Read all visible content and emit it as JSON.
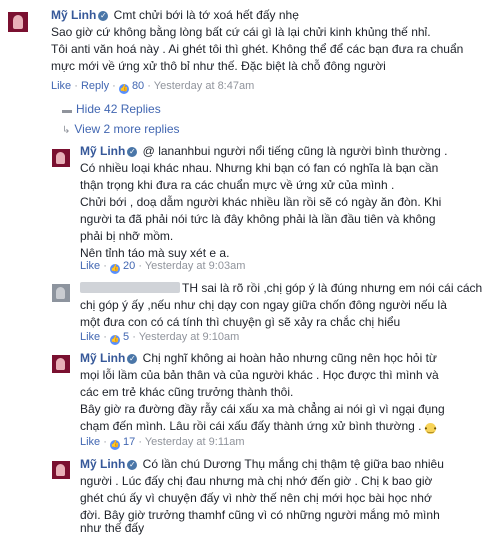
{
  "comments": [
    {
      "name": "Mỹ Linh",
      "lines": [
        "Cmt chửi bới là tớ xoá hết đấy nhẹ",
        "Sao giờ cứ không bằng lòng bất cứ cái gì là lại chửi kinh khủng thế nhỉ.",
        "Tôi anti văn hoá này . Ai ghét tôi thì ghét. Không thể để các bạn đưa ra chuẩn",
        "mực mới về ứng xử thô bỉ như thế. Đặc biệt là chỗ đông người"
      ],
      "like": "Like",
      "reply": "Reply",
      "count": "80",
      "time": "Yesterday at 8:47am"
    }
  ],
  "hide_replies": "Hide 42 Replies",
  "view_more": "View 2 more replies",
  "replies": [
    {
      "name": "Mỹ Linh",
      "lines": [
        "@ lananhbui người nổi tiếng cũng là người bình thường .",
        "Có nhiều loại khác nhau. Nhưng khi bạn có fan có nghĩa là bạn cần",
        "thận trọng khi đưa ra các chuẩn mực về ứng xử của mình .",
        "Chửi bới , doạ dẫm người khác nhiều lần rồi sẽ có ngày ăn đòn. Khi",
        "người ta đã phải nói tức là đây không phải là lần đầu tiên và không",
        "phải bị nhỡ mồm.",
        "Nên tỉnh táo mà suy xét e a."
      ],
      "like": "Like",
      "count": "20",
      "time": "Yesterday at 9:03am"
    },
    {
      "name": "",
      "lines": [
        "TH sai là rõ rồi ,chị góp ý là đúng nhưng em nói cái cách",
        "chị góp ý ấy ,nếu như chị dạy con ngay giữa chốn đông người nếu là",
        "một đưa con có cá tính thì chuyện gì sẽ xảy ra chắc chị hiểu"
      ],
      "like": "Like",
      "count": "5",
      "time": "Yesterday at 9:10am"
    },
    {
      "name": "Mỹ Linh",
      "lines": [
        "Chị nghĩ không ai hoàn hảo nhưng cũng nên học hỏi từ",
        "mọi lỗi lầm của bản thân và của người khác . Học được thì mình và",
        "các em trẻ khác cũng trưởng thành thôi.",
        "Bây giờ ra đường đầy rẫy cái xấu xa mà chẳng ai nói gì vì ngại đụng",
        "chạm đến mình. Lâu rồi cái xấu đấy thành ứng xử bình thường ."
      ],
      "like": "Like",
      "count": "17",
      "time": "Yesterday at 9:11am"
    },
    {
      "name": "Mỹ Linh",
      "lines": [
        "Có lần chú Dương Thụ mắng chị thậm tệ giữa bao nhiêu",
        "người . Lúc đấy chị đau nhưng mà chị nhớ đến giờ . Chị k bao giờ",
        "ghét chú ấy vì chuyện đấy vì nhờ thế nên chị mới học bài học nhớ",
        "đời. Bây giờ trưởng thamhf cũng vì có những người mắng mỏ mình",
        "như thế đấy"
      ]
    }
  ]
}
